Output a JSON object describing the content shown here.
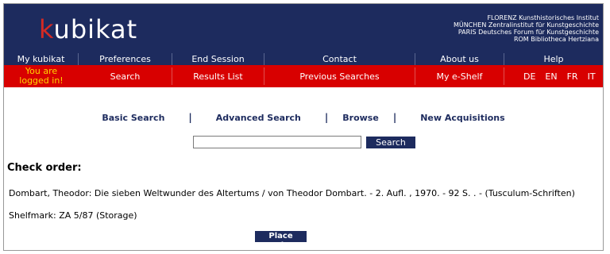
{
  "header": {
    "logo_k": "k",
    "logo_rest": "ubikat",
    "institutes": [
      "FLORENZ Kunsthistorisches Institut",
      "MÜNCHEN Zentralinstitut für Kunstgeschichte",
      "PARIS Deutsches Forum für Kunstgeschichte",
      "ROM Bibliotheca Hertziana"
    ]
  },
  "nav": {
    "items": [
      "My kubikat",
      "Preferences",
      "End Session",
      "Contact",
      "About us",
      "Help"
    ]
  },
  "subnav": {
    "logged_in_line1": "You are",
    "logged_in_line2": "logged in!",
    "items": [
      "Search",
      "Results List",
      "Previous Searches",
      "My e-Shelf"
    ],
    "languages": [
      "DE",
      "EN",
      "FR",
      "IT"
    ]
  },
  "search": {
    "tabs": [
      "Basic Search",
      "Advanced Search",
      "Browse",
      "New Acquisitions"
    ],
    "separator": "|",
    "input_value": "",
    "button_label": "Search"
  },
  "order": {
    "title": "Check order:",
    "record": "Dombart, Theodor: Die sieben Weltwunder des Altertums / von Theodor Dombart. - 2. Aufl. , 1970. - 92 S. . - (Tusculum-Schriften)",
    "shelfmark": "Shelfmark: ZA 5/87 (Storage)",
    "button_label": "Place order"
  },
  "colors": {
    "navy": "#1d2b5e",
    "red": "#d80000",
    "logo_red": "#d42a24",
    "logged_in_yellow": "#ffd400"
  }
}
